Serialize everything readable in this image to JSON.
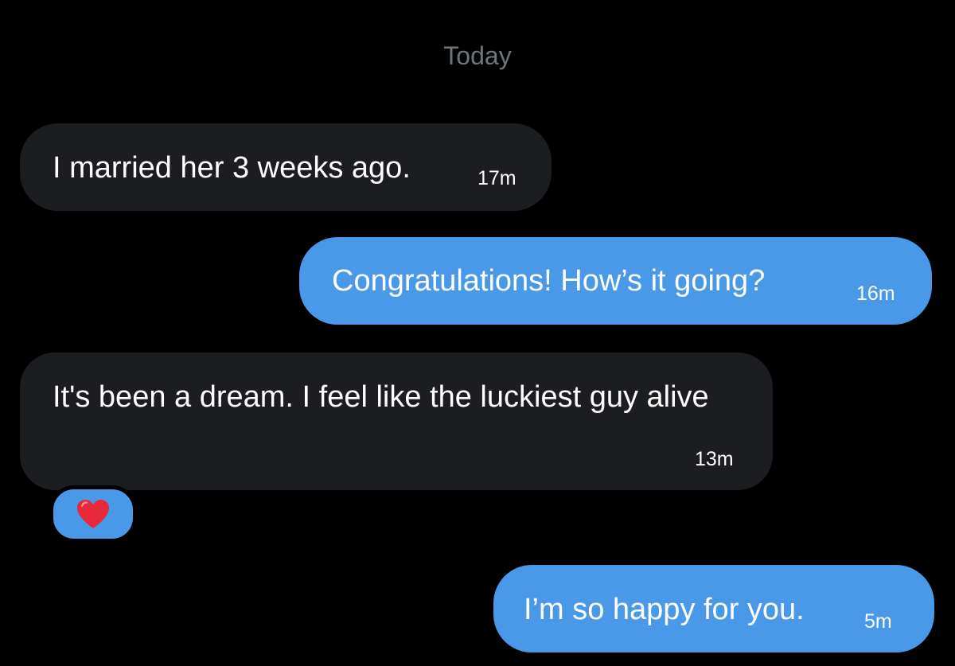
{
  "date_separator": "Today",
  "messages": [
    {
      "direction": "received",
      "text": "I married her 3 weeks ago.",
      "time": "17m"
    },
    {
      "direction": "sent",
      "text": "Congratulations! How’s it going?",
      "time": "16m"
    },
    {
      "direction": "received",
      "text": "It's been a dream. I feel like the luckiest guy alive",
      "time": "13m",
      "reaction": "heart-icon"
    },
    {
      "direction": "sent",
      "text": "I’m so happy for you.",
      "time": "5m"
    }
  ],
  "colors": {
    "background": "#000000",
    "received_bubble": "#1c1d20",
    "sent_bubble": "#4a99e9",
    "date_text": "#6e767d",
    "reaction_heart": "#e8283b"
  }
}
